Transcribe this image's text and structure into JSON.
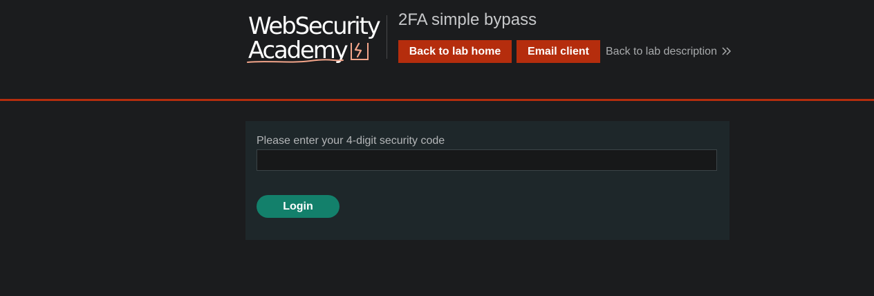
{
  "logo": {
    "line1": "WebSecurity",
    "line2": "Academy",
    "colors": {
      "text": "#ffffff",
      "accent": "#f4a58a"
    },
    "icon": "lightning-bolt-icon"
  },
  "header": {
    "lab_title": "2FA simple bypass",
    "buttons": {
      "lab_home": "Back to lab home",
      "email_client": "Email client"
    },
    "back_link": "Back to lab description",
    "back_link_icon": "double-chevron-right-icon",
    "colors": {
      "button_bg": "#b52d0d",
      "rule": "#b52d0d"
    }
  },
  "form": {
    "label": "Please enter your 4-digit security code",
    "input_value": "",
    "login_label": "Login",
    "colors": {
      "panel_bg": "#1e272a",
      "login_bg": "#13806b"
    }
  }
}
